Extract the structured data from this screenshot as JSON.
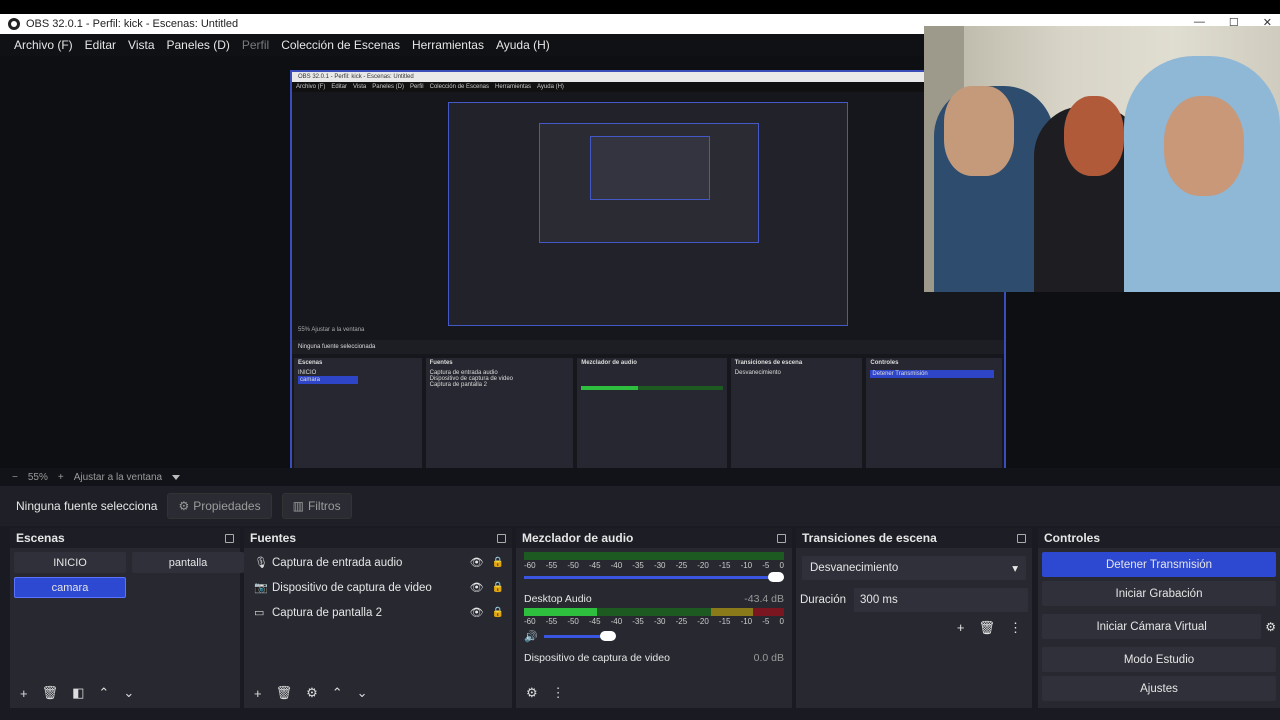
{
  "window": {
    "title": "OBS 32.0.1 - Perfil: kick - Escenas: Untitled"
  },
  "menu": [
    "Archivo (F)",
    "Editar",
    "Vista",
    "Paneles (D)",
    "Perfil",
    "Colección de Escenas",
    "Herramientas",
    "Ayuda (H)"
  ],
  "zoom": {
    "minus": "−",
    "value": "55%",
    "plus": "+",
    "fit": "Ajustar a la ventana"
  },
  "source_bar": {
    "status": "Ninguna fuente selecciona",
    "properties": "Propiedades",
    "filters": "Filtros"
  },
  "scenes": {
    "title": "Escenas",
    "items": [
      "INICIO",
      "pantalla",
      "camara"
    ],
    "active": "camara"
  },
  "sources": {
    "title": "Fuentes",
    "items": [
      "Captura de entrada audio",
      "Dispositivo de captura de video",
      "Captura de pantalla 2"
    ]
  },
  "mixer": {
    "title": "Mezclador de audio",
    "ticks": [
      "-60",
      "-55",
      "-50",
      "-45",
      "-40",
      "-35",
      "-30",
      "-25",
      "-20",
      "-15",
      "-10",
      "-5",
      "0"
    ],
    "channels": [
      {
        "name": "",
        "db": ""
      },
      {
        "name": "Desktop Audio",
        "db": "-43.4 dB"
      },
      {
        "name": "Dispositivo de captura de video",
        "db": "0.0 dB"
      }
    ]
  },
  "transitions": {
    "title": "Transiciones de escena",
    "type": "Desvanecimiento",
    "duration_label": "Duración",
    "duration": "300 ms"
  },
  "controls": {
    "title": "Controles",
    "buttons": [
      "Detener Transmisión",
      "Iniciar Grabación",
      "Iniciar Cámara Virtual",
      "Modo Estudio",
      "Ajustes"
    ],
    "active": "Detener Transmisión"
  },
  "nested": {
    "title": "OBS 32.0.1 - Perfil: kick - Escenas: Untitled",
    "status": "Ninguna fuente seleccionada",
    "zoom": "55%   Ajustar a la ventana"
  }
}
